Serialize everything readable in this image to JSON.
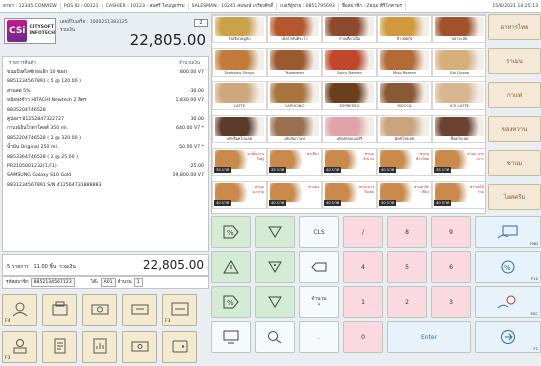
{
  "topbar": {
    "branch": "สาขา : 12345 CONVIEW",
    "pos": "POS ID : 00121",
    "cashier": "CASHIER : 10123 - สมศรี ใจบุญธรรม",
    "salesman": "SALESMAN : 10241 สมพงษ์ เกรียงศักดิ์",
    "mobile": "เบอร์ผู้ขาย : 0851795693",
    "member": "ชื่อสมาชิก : Zอนุ่ม ศิริโภคาพร",
    "clock": "15/6/2021 14:25:13"
  },
  "logo": {
    "mark": "CSi",
    "line1": "CITYSOFT",
    "line2": "INFOTECH"
  },
  "bill": {
    "receipt": "เลขที่ใบเสร็จ : 1000251383125",
    "total_label": "รวมเงิน",
    "customers": "2",
    "total": "22,805.00"
  },
  "list": {
    "col_item": "รายการสินค้า",
    "col_amount": "จำนวนเงิน",
    "rows": [
      {
        "name": "ขนมปังสไลซ์(ห่อเล็ก 10 ซอง)",
        "amt": "800.00 V7"
      },
      {
        "name": "8851234567891 ( 5 @ 120.00 )",
        "amt": ""
      },
      {
        "name": "  ส่วนลด 5%",
        "amt": "-30.00"
      },
      {
        "name": "หม้อหุงข้าว HITACHI Newtech 2 ลิตร",
        "amt": "1,830.00 V7"
      },
      {
        "name": "8835204746528",
        "amt": ""
      },
      {
        "name": "  คูปองฯ 81252847322727",
        "amt": "30.00"
      },
      {
        "name": "กาแฟเย็นโกดาโคลส์ 350 ml.",
        "amt": "640.00 V7 *"
      },
      {
        "name": "8852204746528 ( 2 @ 320.00 )",
        "amt": ""
      },
      {
        "name": "น้ำมัน Original 250 ml.",
        "amt": "50.00 V7 *"
      },
      {
        "name": "8853364746528 ( 2 @ 25.00 )",
        "amt": ""
      },
      {
        "name": "  PR2105001232(1,F1)",
        "amt": "-25.00"
      },
      {
        "name": "SAMSUNG Galaxy S10 Gold",
        "amt": "19,800.00 V7"
      },
      {
        "name": "8831234567891  S/N 412564731888883",
        "amt": ""
      }
    ]
  },
  "summary": {
    "items": "5 รายการ",
    "qty": "11.00",
    "qty_unit": "ชิ้น",
    "total_label": "รวมเงิน",
    "total": "22,805.00"
  },
  "member": {
    "id_label": "รหัสสมาชิก",
    "id_value": "8852134567123",
    "table_label": "โต๊ะ",
    "table": "A01",
    "count_label": "จำนวน",
    "count": "1"
  },
  "fkeys": [
    {
      "label": "F4"
    },
    {
      "label": ""
    },
    {
      "label": ""
    },
    {
      "label": ""
    },
    {
      "label": "F3"
    },
    {
      "label": ""
    },
    {
      "label": ""
    },
    {
      "label": ""
    }
  ],
  "products": [
    {
      "name": "ไข่เจียวหมูสับ",
      "color": "#c9a24a"
    },
    {
      "name": "เบ็ดไก่สันติระโว",
      "color": "#b5562c"
    },
    {
      "name": "ก๋วยเตี๋ยวเนื้อ",
      "color": "#8d4a2e"
    },
    {
      "name": "ข้าวผัดกุ้ง",
      "color": "#d09a3c"
    },
    {
      "name": "ปลาจะลัด",
      "color": "#a0522d"
    },
    {
      "name": "Tonkotsu Shoyu",
      "color": "#c27b3a"
    },
    {
      "name": "Tsukemen",
      "color": "#9c5a30"
    },
    {
      "name": "Spicy Ramen",
      "color": "#c2462b"
    },
    {
      "name": "Miso Ramen",
      "color": "#b46a34"
    },
    {
      "name": "Ebi Gyoza",
      "color": "#d6b07a"
    },
    {
      "name": "LATTE",
      "color": "#cfa77d"
    },
    {
      "name": "CAPUCINO",
      "color": "#a8743f"
    },
    {
      "name": "ESPRESSO",
      "color": "#6b3e1e"
    },
    {
      "name": "MOCCA",
      "color": "#8a5a36"
    },
    {
      "name": "ICE LATTE",
      "color": "#d8b690"
    },
    {
      "name": "เค้กช็อคโกแลต",
      "color": "#5a3a2a"
    },
    {
      "name": "เค้กส้มกาแฟ",
      "color": "#9a7051"
    },
    {
      "name": "เค้กสตรอเบอร์รี่",
      "color": "#e2a3a8"
    },
    {
      "name": "มิลค์โรลเลต",
      "color": "#caa47d"
    },
    {
      "name": "ช็อคโกเลต",
      "color": "#6b4330"
    },
    {
      "name": "",
      "color": "#ffffff",
      "price": "35 บาท",
      "pn": "ชาเย็นจานใหญ่"
    },
    {
      "name": "",
      "color": "#ffffff",
      "price": "35 บาท",
      "pn": "ชาเขียว"
    },
    {
      "name": "",
      "color": "#ffffff",
      "price": "40 บาท",
      "pn": "ชานม จำนวน"
    },
    {
      "name": "",
      "color": "#ffffff",
      "price": "40 บาท",
      "pn": "ชานม ข้าวโพด"
    },
    {
      "name": "",
      "color": "#ffffff",
      "price": "35 บาท",
      "pn": "ชานม จากเกาะ"
    },
    {
      "name": "",
      "color": "#ffffff",
      "price": "40 บาท",
      "pn": "ชานม มะขาม"
    },
    {
      "name": "",
      "color": "#ffffff",
      "price": "40 บาท",
      "pn": "ชาแดง"
    },
    {
      "name": "",
      "color": "#ffffff",
      "price": "40 บาท",
      "pn": "ชามะนาว ใบเตย"
    },
    {
      "name": "",
      "color": "#ffffff",
      "price": "40 บาท",
      "pn": "ชานม ส้มเขียว"
    },
    {
      "name": "",
      "color": "#ffffff",
      "price": "40 บาท",
      "pn": "ชา ผลไม้รวม"
    }
  ],
  "categories": [
    "อาหารไทย",
    "ราเมน",
    "กาแฟ",
    "ของหวาน",
    "ชานม",
    "ไอศครีม"
  ],
  "keypad": {
    "cls": "CLS",
    "div": "/",
    "n8": "8",
    "n9": "9",
    "fnd": "FND",
    "n4": "4",
    "n5": "5",
    "n6": "6",
    "f12": "F12",
    "qty": "จำนวน",
    "mul": "*",
    "n1": "1",
    "n2": "2",
    "n3": "3",
    "esc": "ESC",
    "n0": "0",
    "dot": ".",
    "enter": "Enter",
    "f1": "F1"
  }
}
